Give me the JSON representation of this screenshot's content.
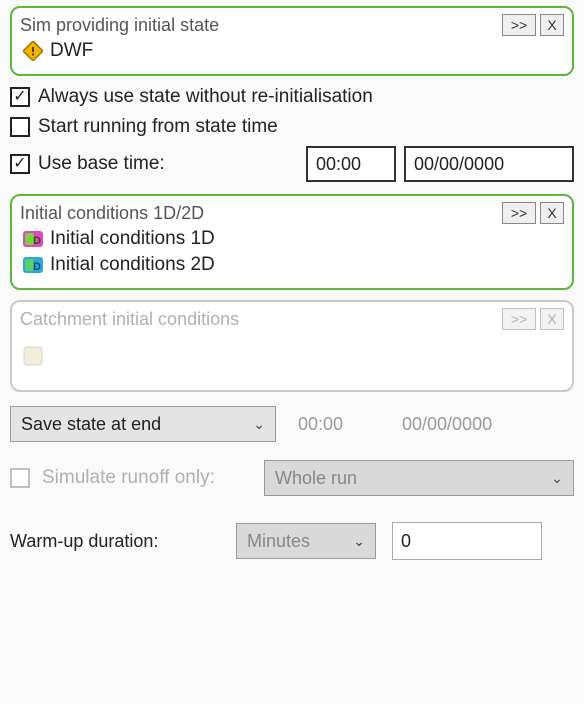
{
  "group1": {
    "title": "Sim providing initial state",
    "item": "DWF",
    "expand": ">>",
    "close": "X"
  },
  "checks": {
    "alwaysUse": {
      "label": "Always use state without re-initialisation",
      "checked": true
    },
    "startFromStateTime": {
      "label": "Start running from state time",
      "checked": false
    },
    "useBaseTime": {
      "label": "Use base time:",
      "checked": true,
      "time": "00:00",
      "date": "00/00/0000"
    }
  },
  "group2": {
    "title": "Initial conditions 1D/2D",
    "item1": "Initial conditions 1D",
    "item2": "Initial conditions 2D",
    "expand": ">>",
    "close": "X"
  },
  "group3": {
    "title": "Catchment initial conditions",
    "expand": ">>",
    "close": "X"
  },
  "saveState": {
    "label": "Save state at end",
    "time": "00:00",
    "date": "00/00/0000"
  },
  "runoff": {
    "label": "Simulate runoff only:",
    "option": "Whole run"
  },
  "warmup": {
    "label": "Warm-up duration:",
    "unit": "Minutes",
    "value": "0"
  }
}
